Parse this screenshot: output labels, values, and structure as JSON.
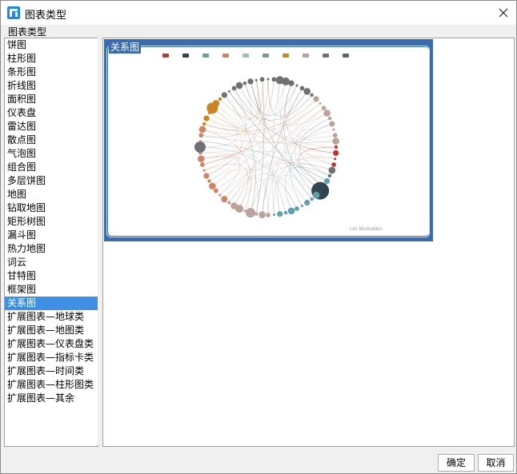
{
  "window": {
    "title": "图表类型"
  },
  "group": {
    "label": "图表类型"
  },
  "chart_types": [
    "饼图",
    "柱形图",
    "条形图",
    "折线图",
    "面积图",
    "仪表盘",
    "雷达图",
    "散点图",
    "气泡图",
    "组合图",
    "多层饼图",
    "地图",
    "钻取地图",
    "矩形树图",
    "漏斗图",
    "热力地图",
    "词云",
    "甘特图",
    "框架图",
    "关系图",
    "扩展图表—地球类",
    "扩展图表—地图类",
    "扩展图表—仪表盘类",
    "扩展图表—指标卡类",
    "扩展图表—时间类",
    "扩展图表—柱形图类",
    "扩展图表—其余"
  ],
  "selected_index": 19,
  "preview": {
    "label": "关系图",
    "watermark": "Les Misérables"
  },
  "buttons": {
    "ok": "确定",
    "cancel": "取消"
  },
  "colors": {
    "selection": "#3f8fe5",
    "preview_border": "#3a6cad",
    "accent": "#1e88e5"
  }
}
